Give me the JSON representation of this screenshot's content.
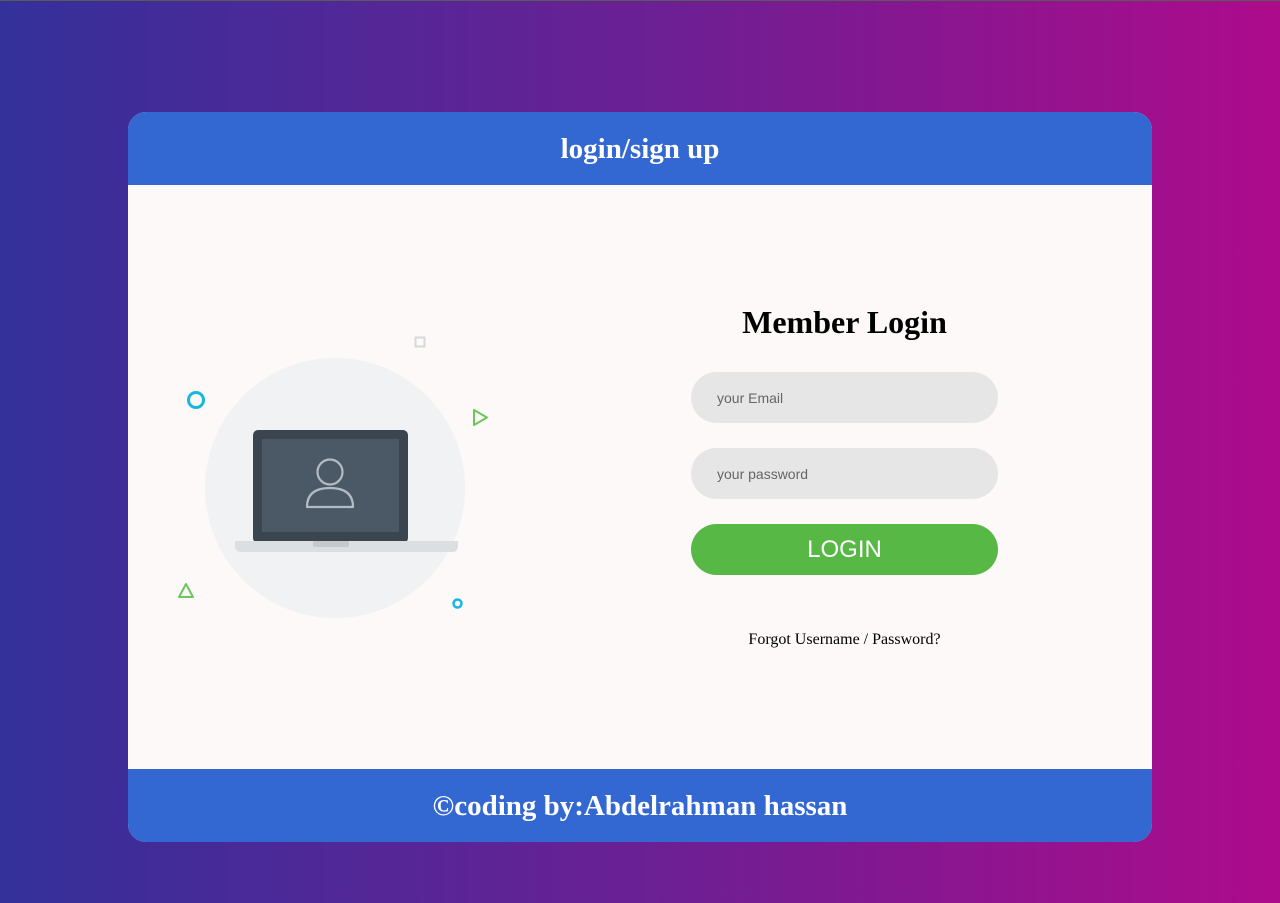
{
  "header": {
    "title": "login/sign up"
  },
  "login": {
    "title": "Member Login",
    "email_placeholder": "your Email",
    "password_placeholder": "your password",
    "button_label": "LOGIN",
    "forgot_username": "Forgot Username",
    "forgot_separator": "/",
    "forgot_password": "Password?"
  },
  "footer": {
    "text": "©coding by:Abdelrahman hassan"
  },
  "colors": {
    "header_bg": "#3367d1",
    "card_bg": "#fcf9f8",
    "button_bg": "#57b846",
    "input_bg": "#e6e6e6",
    "gradient_start": "#34309a",
    "gradient_end": "#ad0b8b"
  },
  "illustration": {
    "icon": "laptop-user-icon",
    "decorations": [
      "circle-icon",
      "square-icon",
      "triangle-icon"
    ]
  }
}
